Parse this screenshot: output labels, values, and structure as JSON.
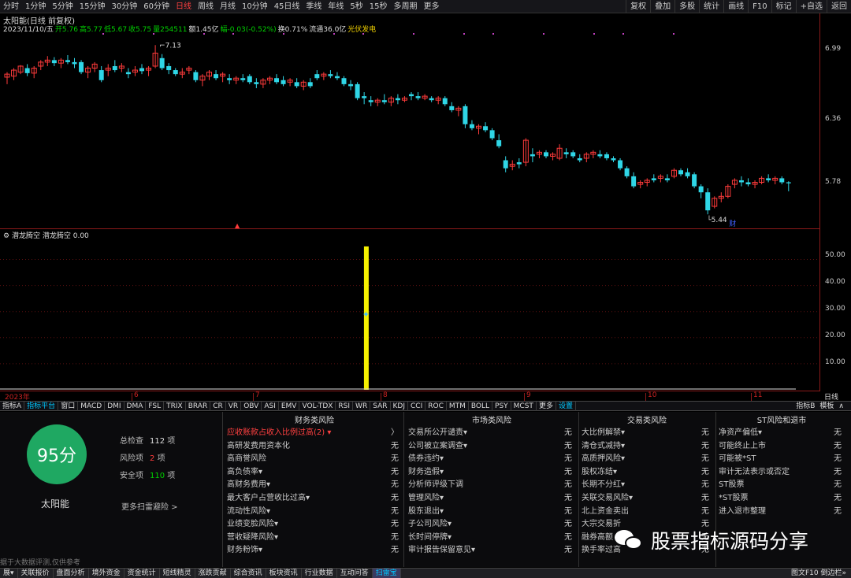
{
  "toolbar": {
    "periods": [
      "分时",
      "1分钟",
      "5分钟",
      "15分钟",
      "30分钟",
      "60分钟",
      "日线",
      "周线",
      "月线",
      "10分钟",
      "45日线",
      "季线",
      "年线",
      "5秒",
      "15秒",
      "多周期",
      "更多"
    ],
    "active_period": "日线",
    "tools": [
      "复权",
      "叠加",
      "多股",
      "统计",
      "画线",
      "F10",
      "标记",
      "+自选",
      "返回"
    ]
  },
  "header": {
    "title": "太阳能(日线 前复权)",
    "info": [
      {
        "t": "2023/11/10/五",
        "cls": "w"
      },
      {
        "t": "开5.76",
        "cls": "g"
      },
      {
        "t": "高5.77",
        "cls": "g"
      },
      {
        "t": "低5.67",
        "cls": "g"
      },
      {
        "t": "收5.75",
        "cls": "g"
      },
      {
        "t": "量254511",
        "cls": "g"
      },
      {
        "t": "额1.45亿",
        "cls": "w"
      },
      {
        "t": "幅-0.03(-0.52%)",
        "cls": "g"
      },
      {
        "t": "换0.71%",
        "cls": "w"
      },
      {
        "t": "流通36.0亿",
        "cls": "w"
      },
      {
        "t": "光伏发电",
        "cls": "y"
      }
    ]
  },
  "price_axis": {
    "labels": [
      "6.99",
      "6.36",
      "5.78"
    ]
  },
  "annotations": {
    "high": "7.13",
    "low": "5.44",
    "marker_cai": "财"
  },
  "indicator": {
    "name": "潜龙腾空",
    "line": "潜龙腾空",
    "value": "0.00"
  },
  "sub_axis": {
    "labels": [
      "50.00",
      "40.00",
      "30.00",
      "20.00",
      "10.00"
    ]
  },
  "dates": [
    "2023年",
    "6",
    "7",
    "8",
    "9",
    "10",
    "11"
  ],
  "period_label": "日线",
  "indicator_tabs": [
    "指标A",
    "指标平台",
    "窗口",
    "MACD",
    "DMI",
    "DMA",
    "FSL",
    "TRIX",
    "BRAR",
    "CR",
    "VR",
    "OBV",
    "ASI",
    "EMV",
    "VOL-TDX",
    "RSI",
    "WR",
    "SAR",
    "KDJ",
    "CCI",
    "ROC",
    "MTM",
    "BOLL",
    "PSY",
    "MCST",
    "更多",
    "设置"
  ],
  "indicator_tabs_right": [
    "指标B",
    "模板",
    "∧"
  ],
  "chart_data": {
    "type": "candlestick",
    "title": "太阳能(日线 前复权)",
    "ylim": [
      5.3,
      7.25
    ],
    "candles": [
      [
        6.81,
        6.86,
        6.74,
        6.84
      ],
      [
        6.82,
        6.9,
        6.78,
        6.88
      ],
      [
        6.86,
        6.93,
        6.84,
        6.92
      ],
      [
        6.9,
        6.94,
        6.82,
        6.85
      ],
      [
        6.85,
        6.92,
        6.8,
        6.9
      ],
      [
        6.92,
        6.98,
        6.88,
        6.96
      ],
      [
        6.96,
        7.02,
        6.92,
        6.98
      ],
      [
        6.98,
        7.01,
        6.92,
        6.95
      ],
      [
        6.95,
        7.0,
        6.9,
        6.98
      ],
      [
        6.98,
        7.03,
        6.94,
        6.96
      ],
      [
        6.96,
        7.0,
        6.9,
        6.94
      ],
      [
        6.96,
        6.98,
        6.84,
        6.86
      ],
      [
        6.86,
        6.92,
        6.8,
        6.9
      ],
      [
        6.9,
        6.96,
        6.86,
        6.94
      ],
      [
        6.88,
        6.92,
        6.76,
        6.78
      ],
      [
        6.88,
        6.94,
        6.82,
        6.9
      ],
      [
        6.92,
        6.98,
        6.86,
        6.88
      ],
      [
        6.9,
        6.95,
        6.86,
        6.92
      ],
      [
        6.86,
        6.9,
        6.8,
        6.84
      ],
      [
        6.86,
        6.92,
        6.82,
        6.88
      ],
      [
        6.9,
        6.94,
        6.84,
        6.87
      ],
      [
        6.88,
        6.92,
        6.82,
        6.9
      ],
      [
        6.92,
        7.13,
        6.9,
        7.05
      ],
      [
        7.0,
        7.04,
        6.88,
        6.9
      ],
      [
        6.92,
        6.95,
        6.84,
        6.88
      ],
      [
        6.88,
        6.9,
        6.82,
        6.84
      ],
      [
        6.84,
        6.9,
        6.8,
        6.86
      ],
      [
        6.88,
        6.92,
        6.84,
        6.9
      ],
      [
        6.86,
        6.88,
        6.76,
        6.78
      ],
      [
        6.78,
        6.84,
        6.72,
        6.82
      ],
      [
        6.82,
        6.88,
        6.78,
        6.86
      ],
      [
        6.84,
        6.88,
        6.78,
        6.8
      ],
      [
        6.82,
        6.86,
        6.76,
        6.84
      ],
      [
        6.8,
        6.84,
        6.74,
        6.78
      ],
      [
        6.78,
        6.82,
        6.74,
        6.8
      ],
      [
        6.8,
        6.84,
        6.76,
        6.78
      ],
      [
        6.82,
        6.84,
        6.74,
        6.76
      ],
      [
        6.76,
        6.8,
        6.7,
        6.74
      ],
      [
        6.74,
        6.8,
        6.7,
        6.78
      ],
      [
        6.78,
        6.82,
        6.74,
        6.8
      ],
      [
        6.8,
        6.84,
        6.74,
        6.76
      ],
      [
        6.78,
        6.82,
        6.72,
        6.74
      ],
      [
        6.76,
        6.8,
        6.72,
        6.78
      ],
      [
        6.76,
        6.8,
        6.7,
        6.72
      ],
      [
        6.72,
        6.78,
        6.68,
        6.76
      ],
      [
        6.76,
        6.8,
        6.7,
        6.72
      ],
      [
        6.84,
        6.88,
        6.78,
        6.8
      ],
      [
        6.82,
        6.86,
        6.78,
        6.84
      ],
      [
        6.84,
        6.88,
        6.8,
        6.82
      ],
      [
        6.82,
        6.86,
        6.78,
        6.8
      ],
      [
        6.8,
        6.82,
        6.72,
        6.74
      ],
      [
        6.74,
        6.78,
        6.68,
        6.72
      ],
      [
        6.74,
        6.76,
        6.58,
        6.6
      ],
      [
        6.62,
        6.66,
        6.54,
        6.6
      ],
      [
        6.58,
        6.62,
        6.52,
        6.56
      ],
      [
        6.56,
        6.6,
        6.52,
        6.58
      ],
      [
        6.58,
        6.64,
        6.54,
        6.56
      ],
      [
        6.56,
        6.62,
        6.52,
        6.6
      ],
      [
        6.6,
        6.64,
        6.54,
        6.58
      ],
      [
        6.58,
        6.62,
        6.56,
        6.6
      ],
      [
        6.64,
        6.66,
        6.58,
        6.62
      ],
      [
        6.62,
        6.66,
        6.58,
        6.6
      ],
      [
        6.6,
        6.64,
        6.58,
        6.62
      ],
      [
        6.6,
        6.62,
        6.56,
        6.58
      ],
      [
        6.58,
        6.62,
        6.54,
        6.6
      ],
      [
        6.6,
        6.62,
        6.52,
        6.54
      ],
      [
        6.52,
        6.56,
        6.46,
        6.48
      ],
      [
        6.48,
        6.52,
        6.42,
        6.5
      ],
      [
        6.52,
        6.54,
        6.3,
        6.34
      ],
      [
        6.34,
        6.38,
        6.28,
        6.3
      ],
      [
        6.3,
        6.34,
        6.24,
        6.32
      ],
      [
        6.32,
        6.36,
        6.26,
        6.28
      ],
      [
        6.28,
        6.3,
        6.18,
        6.2
      ],
      [
        6.18,
        6.24,
        6.1,
        6.12
      ],
      [
        5.98,
        6.02,
        5.86,
        5.9
      ],
      [
        5.92,
        5.98,
        5.88,
        5.94
      ],
      [
        5.96,
        6.0,
        5.9,
        5.94
      ],
      [
        5.96,
        6.2,
        5.92,
        6.18
      ],
      [
        6.04,
        6.1,
        5.96,
        6.02
      ],
      [
        6.04,
        6.08,
        6.0,
        6.06
      ],
      [
        6.06,
        6.08,
        6.0,
        6.02
      ],
      [
        6.02,
        6.06,
        5.98,
        6.04
      ],
      [
        6.0,
        6.14,
        5.98,
        6.1
      ],
      [
        6.06,
        6.1,
        6.0,
        6.04
      ],
      [
        6.06,
        6.08,
        6.0,
        6.02
      ],
      [
        6.0,
        6.04,
        5.96,
        5.98
      ],
      [
        6.0,
        6.06,
        5.96,
        6.04
      ],
      [
        6.04,
        6.08,
        6.0,
        6.06
      ],
      [
        6.04,
        6.08,
        6.0,
        6.02
      ],
      [
        6.04,
        6.06,
        5.98,
        6.0
      ],
      [
        6.0,
        6.02,
        5.96,
        5.98
      ],
      [
        5.98,
        6.0,
        5.88,
        5.9
      ],
      [
        5.9,
        5.92,
        5.8,
        5.82
      ],
      [
        5.82,
        5.86,
        5.7,
        5.72
      ],
      [
        5.74,
        5.78,
        5.7,
        5.76
      ],
      [
        5.76,
        5.8,
        5.72,
        5.78
      ],
      [
        5.8,
        5.84,
        5.76,
        5.78
      ],
      [
        5.8,
        5.84,
        5.76,
        5.82
      ],
      [
        5.8,
        5.84,
        5.76,
        5.78
      ],
      [
        5.82,
        5.9,
        5.8,
        5.88
      ],
      [
        5.88,
        5.9,
        5.82,
        5.84
      ],
      [
        5.86,
        5.9,
        5.8,
        5.82
      ],
      [
        5.84,
        5.86,
        5.7,
        5.72
      ],
      [
        5.72,
        5.74,
        5.6,
        5.66
      ],
      [
        5.66,
        5.7,
        5.44,
        5.48
      ],
      [
        5.52,
        5.62,
        5.5,
        5.6
      ],
      [
        5.6,
        5.66,
        5.56,
        5.62
      ],
      [
        5.62,
        5.74,
        5.6,
        5.72
      ],
      [
        5.74,
        5.8,
        5.7,
        5.78
      ],
      [
        5.78,
        5.82,
        5.72,
        5.76
      ],
      [
        5.76,
        5.8,
        5.72,
        5.74
      ],
      [
        5.74,
        5.78,
        5.7,
        5.76
      ],
      [
        5.76,
        5.82,
        5.74,
        5.8
      ],
      [
        5.8,
        5.84,
        5.76,
        5.78
      ],
      [
        5.78,
        5.82,
        5.74,
        5.8
      ],
      [
        5.8,
        5.82,
        5.74,
        5.76
      ],
      [
        5.76,
        5.77,
        5.67,
        5.75
      ]
    ],
    "indicator_spike": {
      "index": 58,
      "value": 55,
      "marker_value": 29
    }
  },
  "risk": {
    "score": "95分",
    "stock": "太阳能",
    "total_label": "总检查",
    "total": "112",
    "total_unit": "项",
    "risk_label": "风险项",
    "risk": "2",
    "risk_unit": "项",
    "safe_label": "安全项",
    "safe": "110",
    "safe_unit": "项",
    "more": "更多扫雷避险 >",
    "footer": "据于大数据评测,仅供参考",
    "columns": [
      {
        "title": "财务类风险",
        "rows": [
          {
            "k": "应收账款占收入比例过高(2) ▾",
            "v": "〉",
            "red": true
          },
          {
            "k": "高研发费用资本化",
            "v": "无"
          },
          {
            "k": "高商誉风险",
            "v": "无"
          },
          {
            "k": "高负债率▾",
            "v": "无"
          },
          {
            "k": "高财务费用▾",
            "v": "无"
          },
          {
            "k": "最大客户占营收比过高▾",
            "v": "无"
          },
          {
            "k": "流动性风险▾",
            "v": "无"
          },
          {
            "k": "业绩变脸风险▾",
            "v": "无"
          },
          {
            "k": "营收疑降风险▾",
            "v": "无"
          },
          {
            "k": "财务粉饰▾",
            "v": "无"
          }
        ]
      },
      {
        "title": "市场类风险",
        "rows": [
          {
            "k": "交易所公开谴责▾",
            "v": "无"
          },
          {
            "k": "公司被立案调查▾",
            "v": "无"
          },
          {
            "k": "债券违约▾",
            "v": "无"
          },
          {
            "k": "财务造假▾",
            "v": "无"
          },
          {
            "k": "分析师评级下调",
            "v": "无"
          },
          {
            "k": "管理风险▾",
            "v": "无"
          },
          {
            "k": "股东退出▾",
            "v": "无"
          },
          {
            "k": "子公司风险▾",
            "v": "无"
          },
          {
            "k": "长时间停牌▾",
            "v": "无"
          },
          {
            "k": "审计报告保留意见▾",
            "v": "无"
          }
        ]
      },
      {
        "title": "交易类风险",
        "rows": [
          {
            "k": "大比例解禁▾",
            "v": "无"
          },
          {
            "k": "清仓式减持▾",
            "v": "无"
          },
          {
            "k": "高质押风险▾",
            "v": "无"
          },
          {
            "k": "股权冻结▾",
            "v": "无"
          },
          {
            "k": "长期不分红▾",
            "v": "无"
          },
          {
            "k": "关联交易风险▾",
            "v": "无"
          },
          {
            "k": "北上资金卖出",
            "v": "无"
          },
          {
            "k": "大宗交易折",
            "v": "无"
          },
          {
            "k": "融券高额",
            "v": "无"
          },
          {
            "k": "换手率过高",
            "v": "无"
          }
        ]
      },
      {
        "title": "ST风险和退市",
        "rows": [
          {
            "k": "净资产偏低▾",
            "v": "无"
          },
          {
            "k": "可能终止上市",
            "v": "无"
          },
          {
            "k": "可能被*ST",
            "v": "无"
          },
          {
            "k": "审计无法表示或否定",
            "v": "无"
          },
          {
            "k": "ST股票",
            "v": "无"
          },
          {
            "k": "*ST股票",
            "v": "无"
          },
          {
            "k": "进入退市整理",
            "v": "无"
          }
        ]
      }
    ]
  },
  "bottom_tabs": [
    "展▾",
    "关联报价",
    "盘面分析",
    "境外资金",
    "资金统计",
    "短线精灵",
    "涨跌贡献",
    "综合资讯",
    "板块资讯",
    "行业数据",
    "互动问答",
    "扫雷宝"
  ],
  "bottom_active": "扫雷宝",
  "bottom_right": "图文F10 倒边栏»",
  "watermark": "股票指标源码分享",
  "colors": {
    "up": "#ff3b3b",
    "down": "#2fd6e6",
    "spike": "#f5f000",
    "grid": "#8b1a1a"
  }
}
